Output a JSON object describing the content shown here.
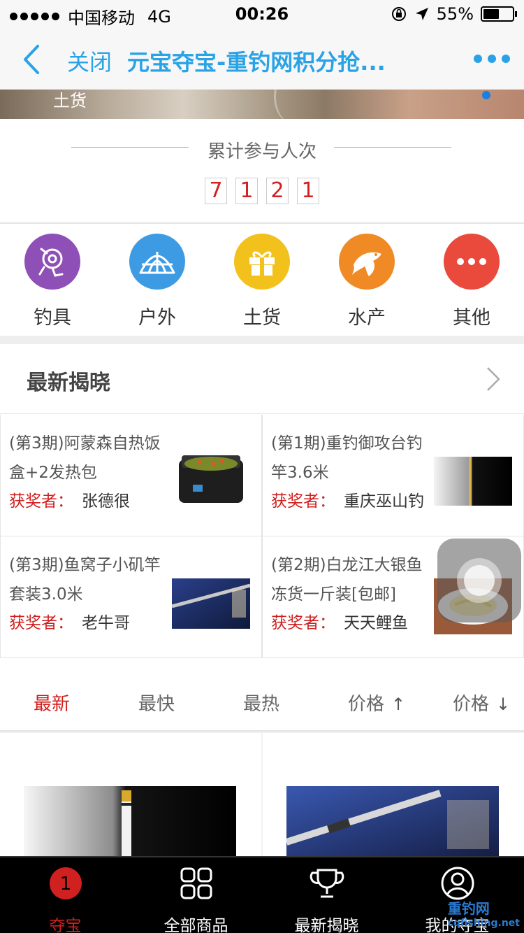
{
  "status_bar": {
    "carrier": "中国移动",
    "network": "4G",
    "time": "00:26",
    "battery": "55%",
    "battery_level": 0.55
  },
  "nav": {
    "close_label": "关闭",
    "title": "元宝夺宝-重钓网积分抢..."
  },
  "banner": {
    "caption": "土货"
  },
  "participation": {
    "title": "累计参与人次",
    "digits": [
      "7",
      "1",
      "2",
      "1"
    ]
  },
  "categories": [
    {
      "label": "钓具",
      "icon": "fishing-reel-icon",
      "color": "#8e4fb6"
    },
    {
      "label": "户外",
      "icon": "tent-icon",
      "color": "#3d9be4"
    },
    {
      "label": "土货",
      "icon": "gift-icon",
      "color": "#f3c11b"
    },
    {
      "label": "水产",
      "icon": "fish-icon",
      "color": "#f08a24"
    },
    {
      "label": "其他",
      "icon": "more-icon",
      "color": "#e94a3b"
    }
  ],
  "latest_reveal": {
    "title": "最新揭晓",
    "winner_label": "获奖者：",
    "items": [
      {
        "name": "(第3期)阿蒙森自热饭盒+2发热包",
        "winner": "张德很"
      },
      {
        "name": "(第1期)重钓御攻台钓竿3.6米",
        "winner": "重庆巫山钓"
      },
      {
        "name": "(第3期)鱼窝子小矶竿套装3.0米",
        "winner": "老牛哥"
      },
      {
        "name": "(第2期)白龙江大银鱼冻货一斤装[包邮]",
        "winner": "天天鲤鱼"
      }
    ]
  },
  "sort_tabs": [
    {
      "label": "最新",
      "active": true
    },
    {
      "label": "最快",
      "active": false
    },
    {
      "label": "最热",
      "active": false
    },
    {
      "label": "价格",
      "active": false,
      "arrow": "↑"
    },
    {
      "label": "价格",
      "active": false,
      "arrow": "↓"
    }
  ],
  "tab_bar": [
    {
      "label": "夺宝",
      "icon": "badge-one-icon",
      "badge": "1",
      "active": true
    },
    {
      "label": "全部商品",
      "icon": "grid-icon",
      "active": false
    },
    {
      "label": "最新揭晓",
      "icon": "trophy-icon",
      "active": false
    },
    {
      "label": "我的夺宝",
      "icon": "user-icon",
      "active": false
    }
  ],
  "watermark": {
    "text": "重钓网",
    "url": "cqfishing.net"
  },
  "colors": {
    "accent_blue": "#2aa3e6",
    "accent_red": "#d0201f"
  }
}
